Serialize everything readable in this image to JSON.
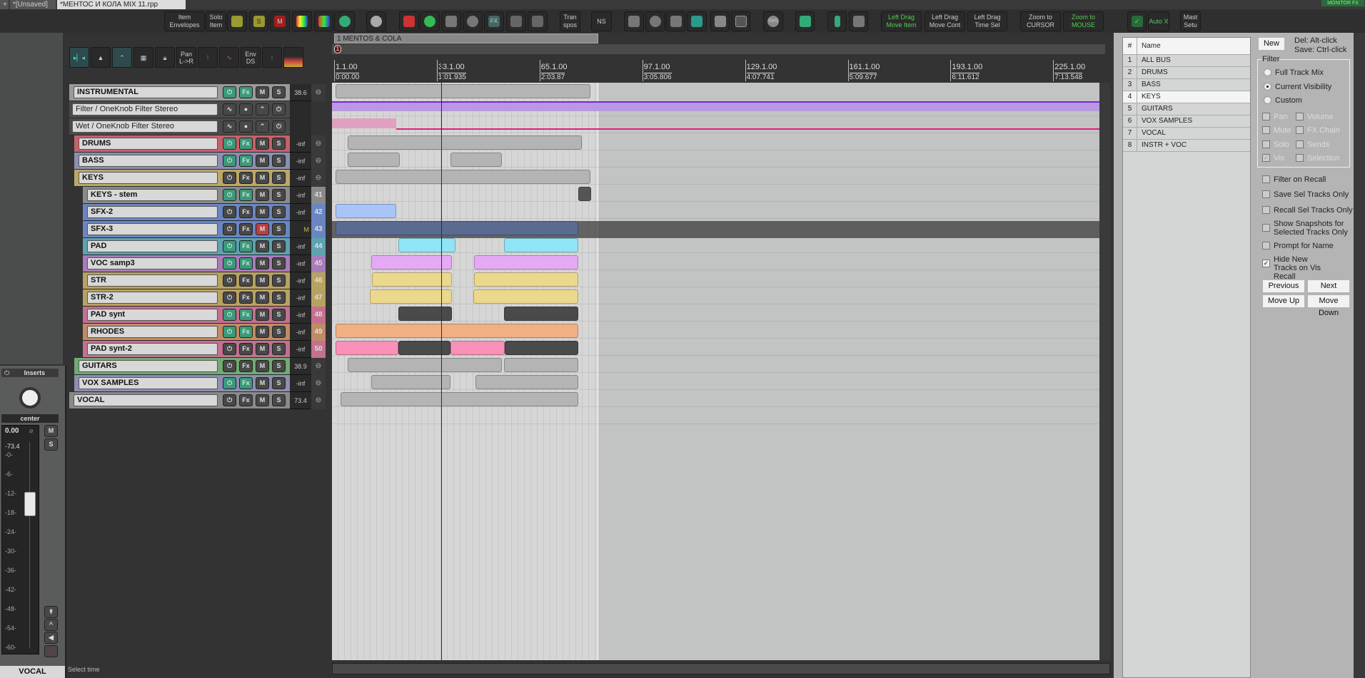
{
  "tabs": [
    {
      "label": "*[Unsaved]"
    },
    {
      "label": "*МЕНТОС И КОЛА MIX 11.rpp"
    }
  ],
  "monitor_fx": "MONITOR FX",
  "toolbar": {
    "item_envelopes": "Item Envelopes",
    "solo_item": "Solo Item",
    "s_label": "S",
    "m_label": "M",
    "transpos": "Tran spos",
    "ns": "NS",
    "fx": "FX",
    "sws": "SWS",
    "left_drag_move_item": "Left Drag Move Item",
    "left_drag_move_cont": "Left Drag Move Cont",
    "left_drag_time_sel": "Left Drag Time Sel",
    "zoom_cursor": "Zoom to CURSOR",
    "zoom_mouse": "Zoom to MOUSE",
    "auto_x": "Auto X",
    "mast_setu": "Mast Setu"
  },
  "tcp_toolbar": {
    "pan_lr": "Pan L->R",
    "env_ds": "Env DS"
  },
  "region": {
    "name": "1  MENTOS & COLA",
    "marker": "1"
  },
  "ruler": [
    {
      "bar": "1.1.00",
      "time": "0:00.00"
    },
    {
      "bar": "33.1.00",
      "time": "1:01.935"
    },
    {
      "bar": "65.1.00",
      "time": "2:03.87"
    },
    {
      "bar": "97.1.00",
      "time": "3:05.806"
    },
    {
      "bar": "129.1.00",
      "time": "4:07.741"
    },
    {
      "bar": "161.1.00",
      "time": "5:09.677"
    },
    {
      "bar": "193.1.00",
      "time": "6:11.612"
    },
    {
      "bar": "225.1.00",
      "time": "7:13.548"
    }
  ],
  "track_buttons": {
    "fx": "Fx",
    "mute": "M",
    "solo": "S"
  },
  "tracks": [
    {
      "name": "INSTRUMENTAL",
      "depth": 0,
      "color": "#9a9a9a",
      "vol": "38.6",
      "num": "",
      "active": true
    },
    {
      "name": "Filter / OneKnob Filter Stereo",
      "env": true
    },
    {
      "name": "Wet / OneKnob Filter Stereo",
      "env": true
    },
    {
      "name": "DRUMS",
      "depth": 1,
      "color": "#c8606a",
      "vol": "-inf",
      "num": "",
      "active": true
    },
    {
      "name": "BASS",
      "depth": 1,
      "color": "#8c8eb2",
      "vol": "-inf",
      "num": "",
      "active": true
    },
    {
      "name": "KEYS",
      "depth": 1,
      "color": "#bca866",
      "vol": "-inf",
      "num": "",
      "active": false
    },
    {
      "name": "KEYS - stem",
      "depth": 2,
      "color": "#8a8a8a",
      "vol": "-inf",
      "num": "41",
      "active": true
    },
    {
      "name": "SFX-2",
      "depth": 2,
      "color": "#6a86c2",
      "vol": "-inf",
      "num": "42",
      "active": false
    },
    {
      "name": "SFX-3",
      "depth": 2,
      "color": "#6a86c2",
      "vol": "M",
      "num": "43",
      "active": false,
      "muted": true
    },
    {
      "name": "PAD",
      "depth": 2,
      "color": "#5ea2b0",
      "vol": "-inf",
      "num": "44",
      "active": true
    },
    {
      "name": "VOC samp3",
      "depth": 2,
      "color": "#a87cba",
      "vol": "-inf",
      "num": "45",
      "active": true
    },
    {
      "name": "STR",
      "depth": 2,
      "color": "#b8a262",
      "vol": "-inf",
      "num": "46",
      "active": false
    },
    {
      "name": "STR-2",
      "depth": 2,
      "color": "#b8a262",
      "vol": "-inf",
      "num": "47",
      "active": false
    },
    {
      "name": "PAD synt",
      "depth": 2,
      "color": "#c47090",
      "vol": "-inf",
      "num": "48",
      "active": true
    },
    {
      "name": "RHODES",
      "depth": 2,
      "color": "#c08c64",
      "vol": "-inf",
      "num": "49",
      "active": true
    },
    {
      "name": "PAD synt-2",
      "depth": 2,
      "color": "#c47090",
      "vol": "-inf",
      "num": "50",
      "active": false
    },
    {
      "name": "GUITARS",
      "depth": 1,
      "color": "#72aa74",
      "vol": "38.9",
      "num": "",
      "active": false
    },
    {
      "name": "VOX SAMPLES",
      "depth": 1,
      "color": "#8c8eb2",
      "vol": "-inf",
      "num": "",
      "active": true
    },
    {
      "name": "VOCAL",
      "depth": 0,
      "color": "#8a8a8a",
      "vol": "73.4",
      "num": "",
      "active": false
    }
  ],
  "mixer": {
    "inserts": "Inserts",
    "pan": "center",
    "vol": "0.00",
    "peak": "-73.4",
    "scale": [
      "-0-",
      "-6-",
      "-12-",
      "-18-",
      "-24-",
      "-30-",
      "-36-",
      "-42-",
      "-48-",
      "-54-",
      "-60-"
    ],
    "mute": "M",
    "solo": "S",
    "track": "VOCAL"
  },
  "status": "Select time",
  "snapshots": {
    "col_num": "#",
    "col_name": "Name",
    "rows": [
      {
        "n": "1",
        "name": "ALL BUS"
      },
      {
        "n": "2",
        "name": "DRUMS"
      },
      {
        "n": "3",
        "name": "BASS"
      },
      {
        "n": "4",
        "name": "KEYS",
        "selected": true
      },
      {
        "n": "5",
        "name": "GUITARS"
      },
      {
        "n": "6",
        "name": "VOX SAMPLES"
      },
      {
        "n": "7",
        "name": "VOCAL"
      },
      {
        "n": "8",
        "name": "INSTR + VOC"
      }
    ],
    "new": "New",
    "hint1": "Del: Alt-click",
    "hint2": "Save: Ctrl-click",
    "filter": "Filter",
    "full_mix": "Full Track Mix",
    "current_vis": "Current Visibility",
    "custom": "Custom",
    "pan": "Pan",
    "volume": "Volume",
    "mute": "Mute",
    "fx_chain": "FX Chain",
    "solo": "Solo",
    "sends": "Sends",
    "vis": "Vis",
    "selection": "Selection",
    "filter_recall": "Filter on Recall",
    "save_sel": "Save Sel Tracks Only",
    "recall_sel": "Recall Sel Tracks Only",
    "show_snap": "Show Snapshots for Selected Tracks Only",
    "prompt": "Prompt for Name",
    "hide_new": "Hide New Tracks on Vis Recall",
    "previous": "Previous",
    "next": "Next",
    "move_up": "Move Up",
    "move_down": "Move Down"
  }
}
